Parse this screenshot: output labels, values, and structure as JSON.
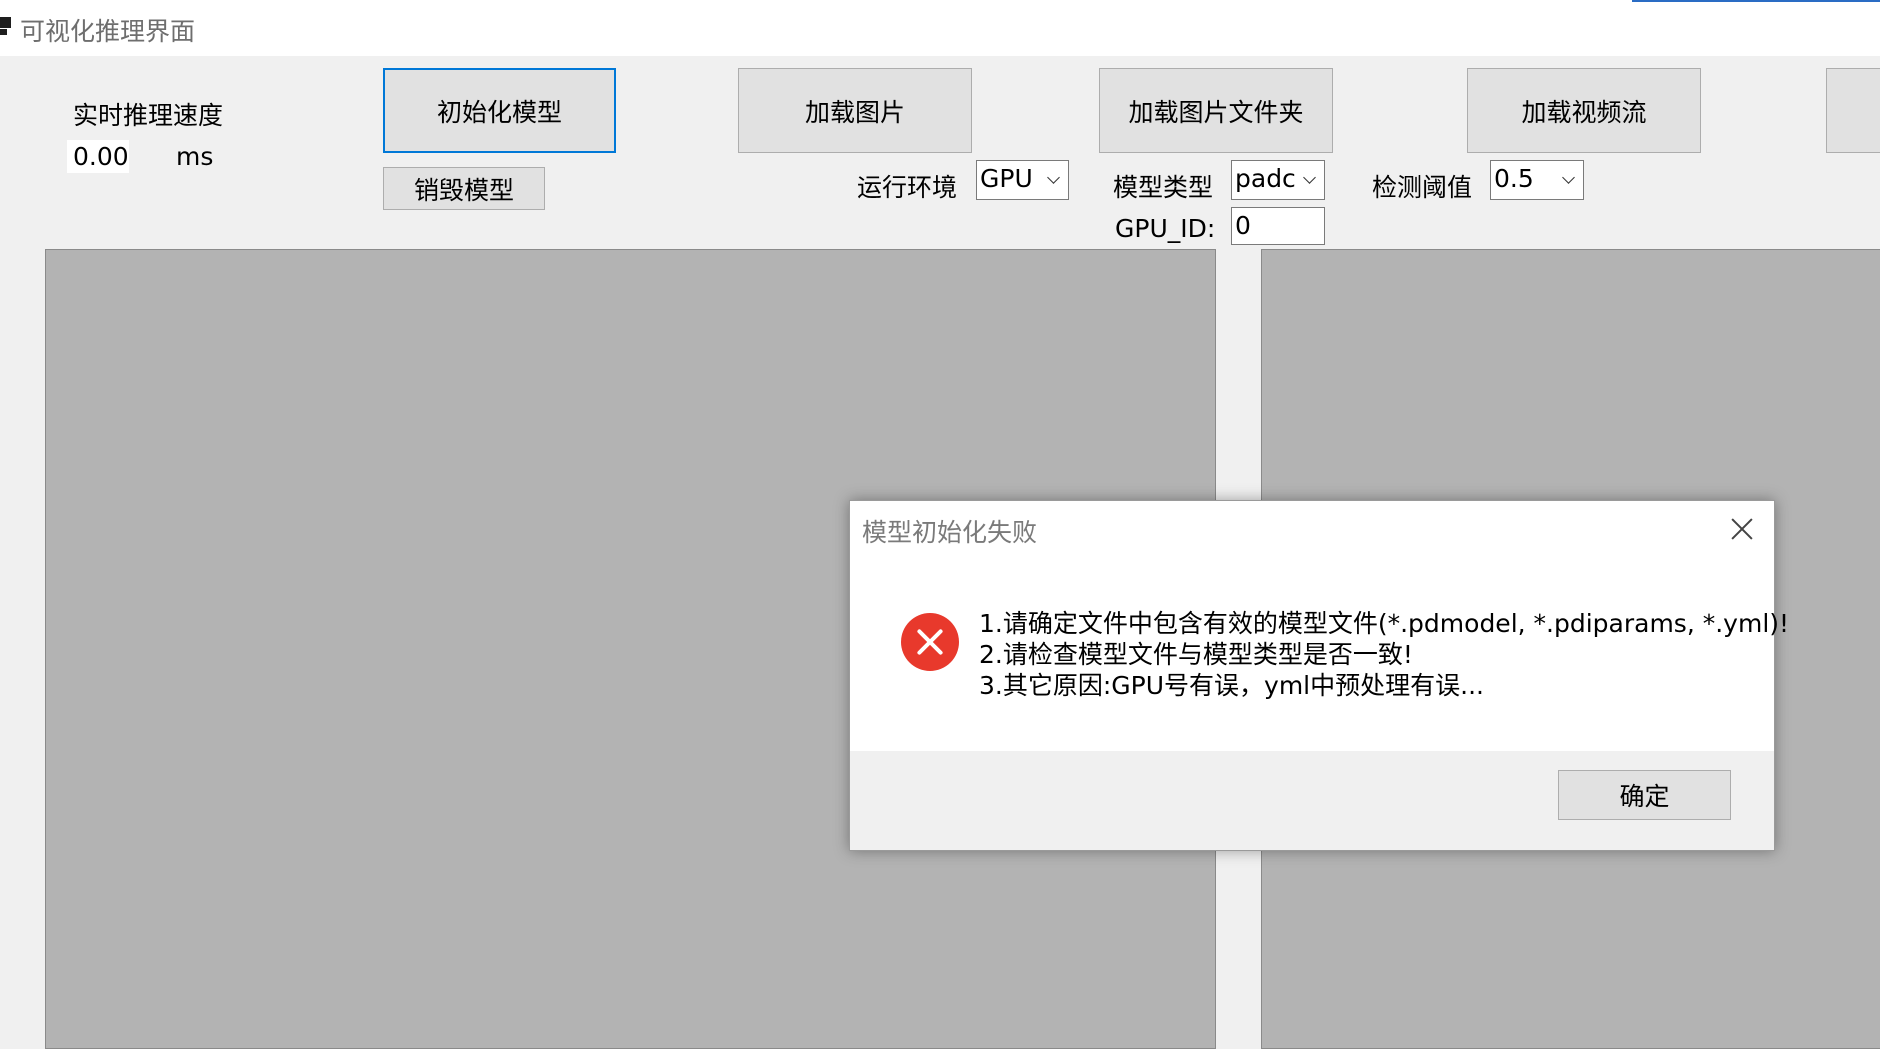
{
  "window": {
    "title": "可视化推理界面"
  },
  "toolbar": {
    "speed_label": "实时推理速度",
    "speed_value": "0.00",
    "speed_unit": "ms",
    "init_model": "初始化模型",
    "destroy_model": "销毁模型",
    "load_image": "加载图片",
    "load_image_folder": "加载图片文件夹",
    "load_video_stream": "加载视频流"
  },
  "settings": {
    "run_env_label": "运行环境",
    "run_env_value": "GPU",
    "model_type_label": "模型类型",
    "model_type_value": "padc",
    "threshold_label": "检测阈值",
    "threshold_value": "0.5",
    "gpu_id_label": "GPU_ID:",
    "gpu_id_value": "0"
  },
  "dialog": {
    "title": "模型初始化失败",
    "lines": [
      "1.请确定文件中包含有效的模型文件(*.pdmodel, *.pdiparams, *.yml)!",
      "2.请检查模型文件与模型类型是否一致!",
      "3.其它原因:GPU号有误，yml中预处理有误..."
    ],
    "ok_label": "确定"
  },
  "colors": {
    "window_bg": "#f0f0f0",
    "canvas_bg": "#b3b3b3",
    "focus_border": "#0078d7",
    "error_icon": "#e8392c"
  },
  "icons": [
    "app-icon",
    "error-icon",
    "close-icon",
    "chevron-down-icon"
  ]
}
